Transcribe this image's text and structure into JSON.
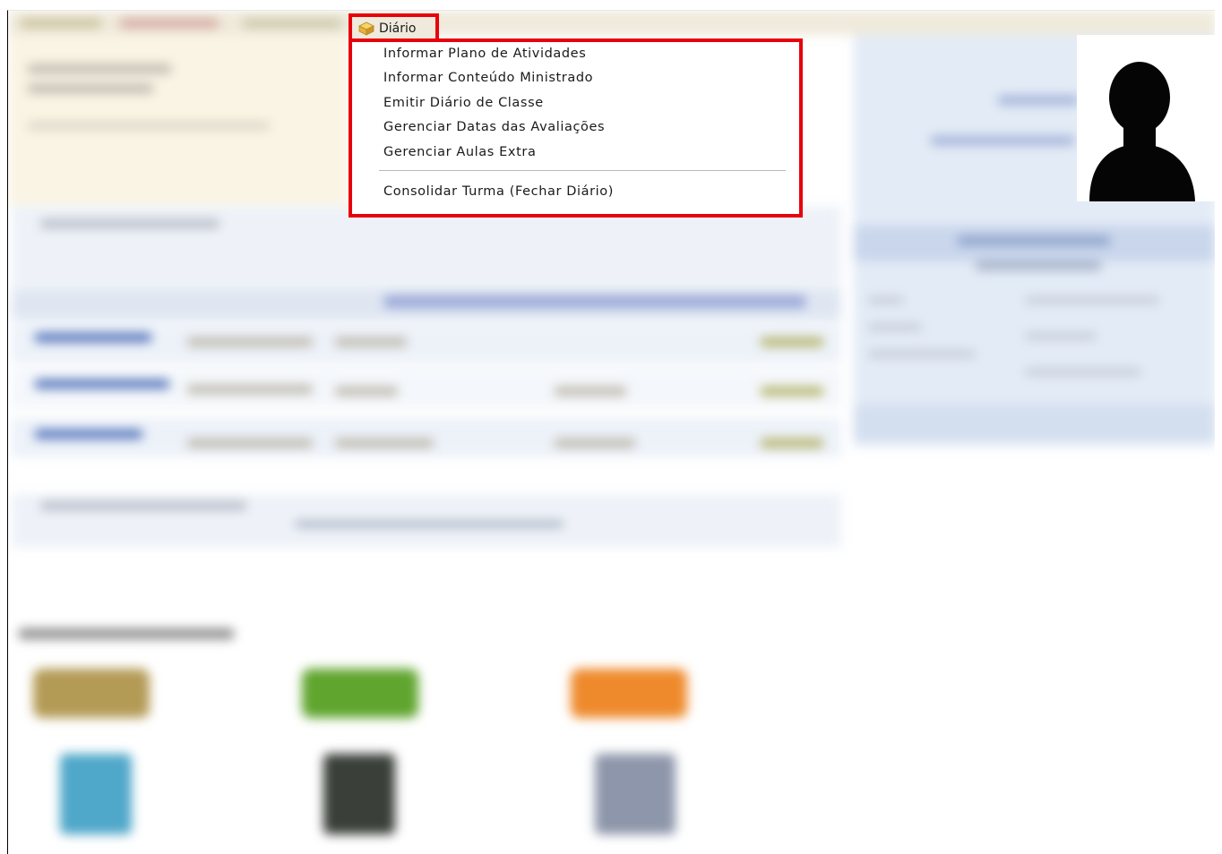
{
  "menubar": {
    "diario": {
      "label": "Diário",
      "icon": "package-box-icon"
    }
  },
  "dropdown": {
    "items": [
      {
        "label": "Informar Plano de Atividades"
      },
      {
        "label": "Informar Conteúdo Ministrado"
      },
      {
        "label": "Emitir Diário de Classe"
      },
      {
        "label": "Gerenciar Datas das Avaliações"
      },
      {
        "label": "Gerenciar Aulas Extra"
      }
    ],
    "after_separator": [
      {
        "label": "Consolidar Turma (Fechar Diário)"
      }
    ]
  },
  "highlight_color": "#e8000b",
  "menubar_color": "#efeadb"
}
